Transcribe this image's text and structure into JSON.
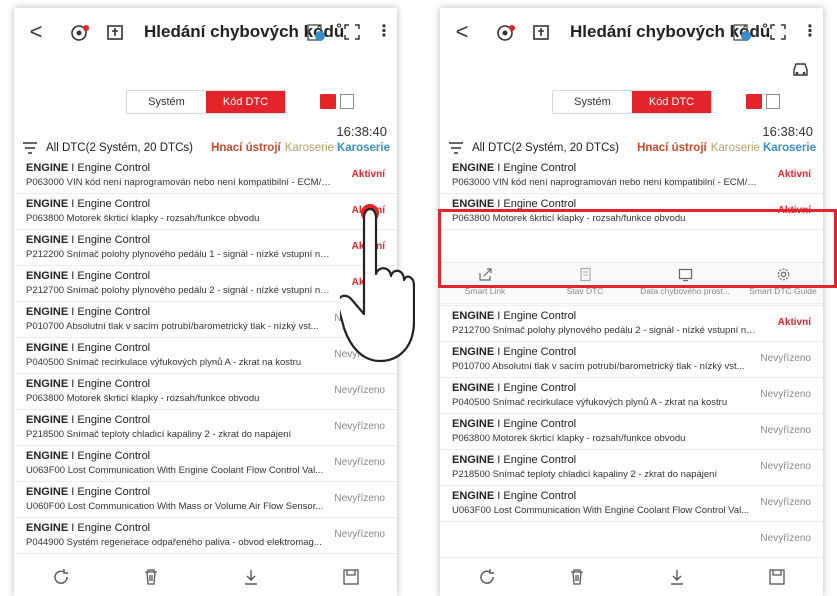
{
  "app": {
    "title": "Hledání chybových kódů",
    "back_label": "<",
    "more_label": "⋮"
  },
  "segment": {
    "system_label": "Systém",
    "dtc_label": "Kód DTC"
  },
  "summary": {
    "time": "16:38:40",
    "all_label": "All DTC(2 Systém, 20 DTCs)",
    "header1": "Hnací ústrojí",
    "header2": "Karoserie",
    "header3": "Karoserie"
  },
  "left_rows": [
    {
      "system": "ENGINE",
      "subsystem": "Engine Control",
      "code": "P063000 VIN kód není naprogramován nebo není kompatibilní - ECM/PCM",
      "status": "Aktivní",
      "active": true
    },
    {
      "system": "ENGINE",
      "subsystem": "Engine Control",
      "code": "P063800 Motorek škrticí klapky - rozsah/funkce obvodu",
      "status": "Aktivní",
      "active": true
    },
    {
      "system": "ENGINE",
      "subsystem": "Engine Control",
      "code": "P212200 Snímač polohy plynového pedálu 1 - signál - nízké vstupní napě...",
      "status": "Aktivní",
      "active": true
    },
    {
      "system": "ENGINE",
      "subsystem": "Engine Control",
      "code": "P212700 Snímač polohy plynového pedálu 2 - signál - nízké vstupní napě...",
      "status": "Aktivní",
      "active": true
    },
    {
      "system": "ENGINE",
      "subsystem": "Engine Control",
      "code": "P010700 Absolutní tlak v sacím potrubí/barometrický tlak - nízký vst...",
      "status": "Nevyřízeno",
      "active": false
    },
    {
      "system": "ENGINE",
      "subsystem": "Engine Control",
      "code": "P040500 Snímač recirkulace výfukových plynů A - zkrat na kostru",
      "status": "Nevyřízeno",
      "active": false
    },
    {
      "system": "ENGINE",
      "subsystem": "Engine Control",
      "code": "P063800 Motorek škrticí klapky - rozsah/funkce obvodu",
      "status": "Nevyřízeno",
      "active": false
    },
    {
      "system": "ENGINE",
      "subsystem": "Engine Control",
      "code": "P218500 Snímač teploty chladicí kapaliny 2 - zkrat do napájení",
      "status": "Nevyřízeno",
      "active": false
    },
    {
      "system": "ENGINE",
      "subsystem": "Engine Control",
      "code": "U063F00 Lost Communication With Engine Coolant Flow Control Val...",
      "status": "Nevyřízeno",
      "active": false
    },
    {
      "system": "ENGINE",
      "subsystem": "Engine Control",
      "code": "U060F00 Lost Communication With Mass or Volume Air Flow Sensor...",
      "status": "Nevyřízeno",
      "active": false
    },
    {
      "system": "ENGINE",
      "subsystem": "Engine Control",
      "code": "P044900 Systém regenerace odpařeného paliva - obvod elektromag...",
      "status": "Nevyřízeno",
      "active": false
    }
  ],
  "right_rows": [
    {
      "system": "ENGINE",
      "subsystem": "Engine Control",
      "code": "P063000 VIN kód není naprogramován nebo není kompatibilní - ECM/PCM",
      "status": "Aktivní",
      "active": true
    },
    {
      "system": "ENGINE",
      "subsystem": "Engine Control",
      "code": "P063800 Motorek škrticí klapky - rozsah/funkce obvodu",
      "status": "Aktivní",
      "active": true
    },
    {
      "system": "ENGINE",
      "subsystem": "Engine Control",
      "code": "P212200 Snímač polohy plynového pedálu 1 - signál - nízké vstupní napě...",
      "status": "Aktivní",
      "active": true
    },
    {
      "system": "ENGINE",
      "subsystem": "Engine Control",
      "code": "P212700 Snímač polohy plynového pedálu 2 - signál - nízké vstupní napě...",
      "status": "Aktivní",
      "active": true
    },
    {
      "system": "ENGINE",
      "subsystem": "Engine Control",
      "code": "P010700 Absolutní tlak v sacím potrubí/barometrický tlak - nízký vst...",
      "status": "Nevyřízeno",
      "active": false
    },
    {
      "system": "ENGINE",
      "subsystem": "Engine Control",
      "code": "P040500 Snímač recirkulace výfukových plynů A - zkrat na kostru",
      "status": "Nevyřízeno",
      "active": false
    },
    {
      "system": "ENGINE",
      "subsystem": "Engine Control",
      "code": "P063800 Motorek škrticí klapky - rozsah/funkce obvodu",
      "status": "Nevyřízeno",
      "active": false
    },
    {
      "system": "ENGINE",
      "subsystem": "Engine Control",
      "code": "P218500 Snímač teploty chladicí kapaliny 2 - zkrat do napájení",
      "status": "Nevyřízeno",
      "active": false
    },
    {
      "system": "ENGINE",
      "subsystem": "Engine Control",
      "code": "U063F00 Lost Communication With Engine Coolant Flow Control Val...",
      "status": "Nevyřízeno",
      "active": false
    },
    {
      "system": "",
      "subsystem": "",
      "code": "",
      "status": "Nevyřízeno",
      "active": false
    }
  ],
  "actions": [
    {
      "label": "Smart Link",
      "icon": "share-icon"
    },
    {
      "label": "Stav DTC",
      "icon": "document-icon"
    },
    {
      "label": "Data chybového prost...",
      "icon": "monitor-icon"
    },
    {
      "label": "Smart DTC Guide",
      "icon": "gear-icon"
    }
  ],
  "bottom_icons": [
    "refresh-icon",
    "delete-icon",
    "download-icon",
    "save-icon"
  ],
  "colors": {
    "accent": "#e3242b",
    "active": "#e3242b",
    "pending": "#888888"
  }
}
